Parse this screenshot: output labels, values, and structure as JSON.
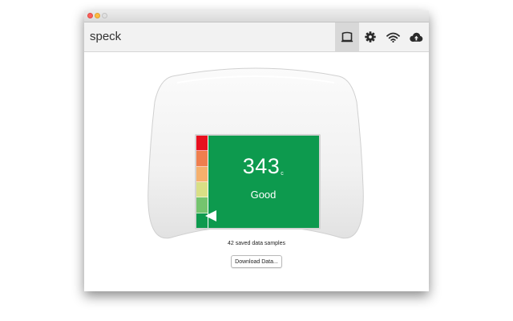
{
  "app": {
    "name": "speck"
  },
  "toolbar": {
    "buttons": [
      {
        "icon": "device-icon",
        "active": true
      },
      {
        "icon": "gear-icon",
        "active": false
      },
      {
        "icon": "wifi-icon",
        "active": false
      },
      {
        "icon": "cloud-upload-icon",
        "active": false
      }
    ]
  },
  "device": {
    "reading_value": "343",
    "reading_unit": "c",
    "reading_label": "Good",
    "screen_color": "#0d9a4e",
    "scale_colors": [
      "#e8101e",
      "#ef7e4e",
      "#f5b06c",
      "#d9df85",
      "#74c46e",
      "#0d9a4e"
    ]
  },
  "main": {
    "samples_text": "42 saved data samples",
    "download_label": "Download Data..."
  }
}
